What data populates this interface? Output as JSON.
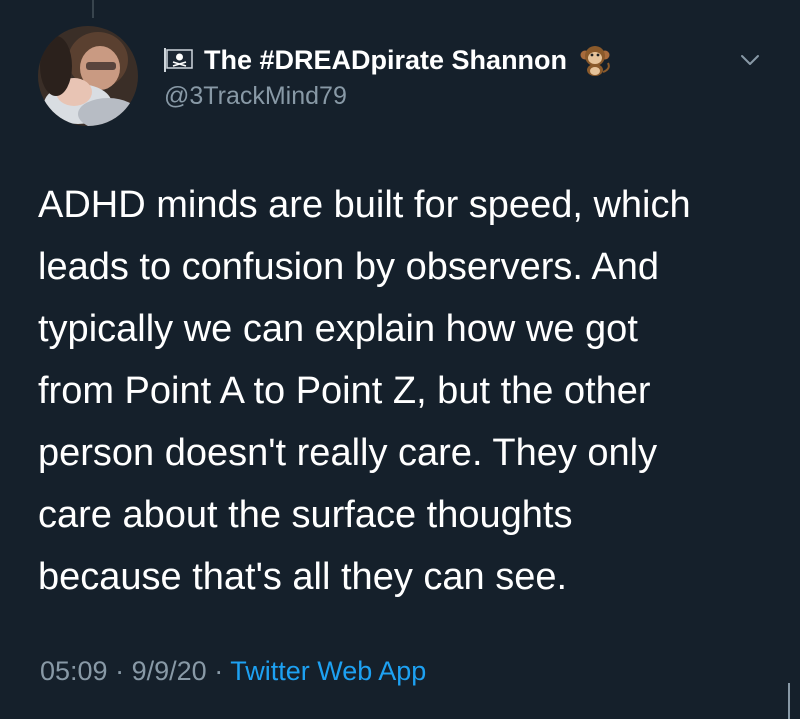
{
  "tweet": {
    "display_name": "The #DREADpirate Shannon",
    "handle": "@3TrackMind79",
    "text_lines": [
      "ADHD minds are built for speed, which",
      "leads to confusion by observers. And",
      "typically we can explain how we got",
      "from Point A to Point Z, but the other",
      "person doesn't really care. They only",
      "care about the surface thoughts",
      "because that's all they can see."
    ],
    "time": "05:09",
    "separator": "·",
    "date": "9/9/20",
    "source": "Twitter Web App"
  },
  "icons": {
    "flag": "pirate-flag-icon",
    "emoji": "monkey-emoji-icon",
    "menu": "chevron-down-icon"
  },
  "colors": {
    "background": "#15202b",
    "text": "#ffffff",
    "secondary": "#8899a6",
    "link": "#1da1f2"
  }
}
